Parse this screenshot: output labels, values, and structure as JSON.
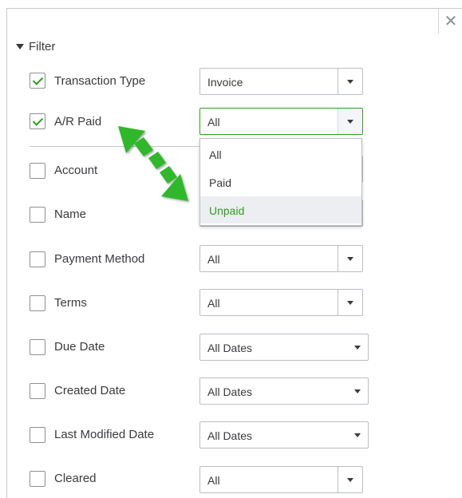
{
  "close_glyph": "✕",
  "filter": {
    "label": "Filter"
  },
  "rows": [
    {
      "label": "Transaction Type",
      "checked": true,
      "value": "Invoice"
    },
    {
      "label": "A/R Paid",
      "checked": true,
      "value": "All"
    },
    {
      "label": "Account",
      "checked": false
    },
    {
      "label": "Name",
      "checked": false
    },
    {
      "label": "Payment Method",
      "checked": false,
      "value": "All"
    },
    {
      "label": "Terms",
      "checked": false,
      "value": "All"
    },
    {
      "label": "Due Date",
      "checked": false,
      "value": "All Dates"
    },
    {
      "label": "Created Date",
      "checked": false,
      "value": "All Dates"
    },
    {
      "label": "Last Modified Date",
      "checked": false,
      "value": "All Dates"
    },
    {
      "label": "Cleared",
      "checked": false,
      "value": "All"
    }
  ],
  "dropdown": {
    "options": [
      "All",
      "Paid",
      "Unpaid"
    ],
    "highlighted": "Unpaid"
  },
  "colors": {
    "accent": "#2ca01c",
    "annotation_arrow": "#2ca01c"
  },
  "icons": {
    "close": "close-icon",
    "expand": "triangle-down-icon",
    "annotation": "double-headed-arrow"
  }
}
